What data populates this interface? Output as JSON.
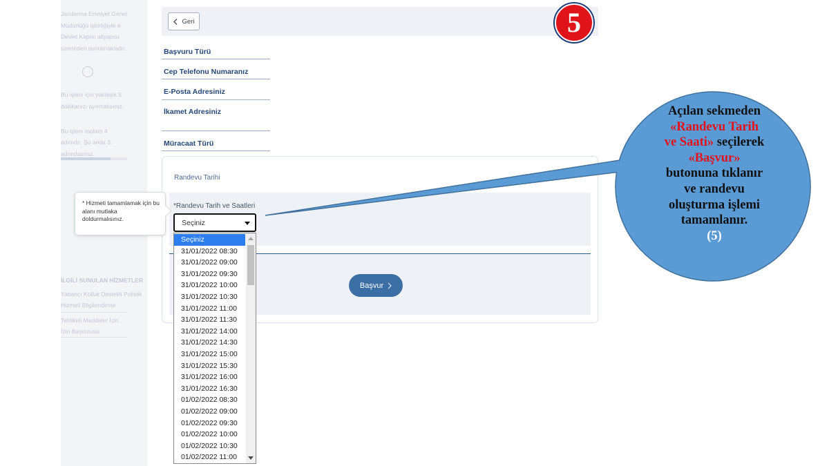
{
  "sidebar": {
    "faded_texts": [
      "Jandarma Emniyet Genel",
      "Müdürlüğü işbirliğiyle e-",
      "Devlet Kapısı altyapısı",
      "üzerinden sunulmaktadır.",
      "Bu işlem için yaklaşık 5",
      "dakikanızı ayırmalısınız.",
      "Bu işlem toplam 4",
      "adımdır. Şu anda 3.",
      "adımdasınız.",
      "İLGİLİ SUNULAN HİZMETLER",
      "Yabancı Kolluk Destekli Polislik",
      "Hizmeti Bilgilendirme",
      "Tehlikeli Maddeler İçin",
      "İzin Başvurusu"
    ],
    "progress_fraction": 0.75
  },
  "header": {
    "back_label": "Geri",
    "back_icon": "chevron-left-icon",
    "step_number": "5"
  },
  "form_fields": [
    "Başvuru Türü",
    "Cep Telefonu Numaranız",
    "E-Posta Adresiniz",
    "İkamet Adresiniz",
    "Müracaat Türü"
  ],
  "appointment": {
    "card_title": "Randevu Tarihi",
    "field_label": "*Randevu Tarih ve Saatleri",
    "selected_value": "Seçiniz",
    "apply_label": "Başvur",
    "apply_icon": "chevron-right-icon"
  },
  "tooltip": {
    "text": "* Hizmeti tamamlamak için bu alanı mutlaka doldurmalısınız."
  },
  "dropdown": {
    "options": [
      "Seçiniz",
      "31/01/2022 08:30",
      "31/01/2022 09:00",
      "31/01/2022 09:30",
      "31/01/2022 10:00",
      "31/01/2022 10:30",
      "31/01/2022 11:00",
      "31/01/2022 11:30",
      "31/01/2022 14:00",
      "31/01/2022 14:30",
      "31/01/2022 15:00",
      "31/01/2022 15:30",
      "31/01/2022 16:00",
      "31/01/2022 16:30",
      "01/02/2022 08:30",
      "01/02/2022 09:00",
      "01/02/2022 09:30",
      "01/02/2022 10:00",
      "01/02/2022 10:30",
      "01/02/2022 11:00"
    ],
    "highlighted_index": 0
  },
  "callout": {
    "line1": "Açılan sekmeden",
    "line2": "«Randevu Tarih",
    "line3a": "ve Saati»",
    "line3b": " seçilerek",
    "line4": "«Başvur»",
    "line5": "butonuna tıklanır",
    "line6": "ve randevu",
    "line7": "oluşturma işlemi",
    "line8": "tamamlanır.",
    "line9": "(5)",
    "fill_color": "#5b9bd5",
    "border_color": "#41719c"
  }
}
